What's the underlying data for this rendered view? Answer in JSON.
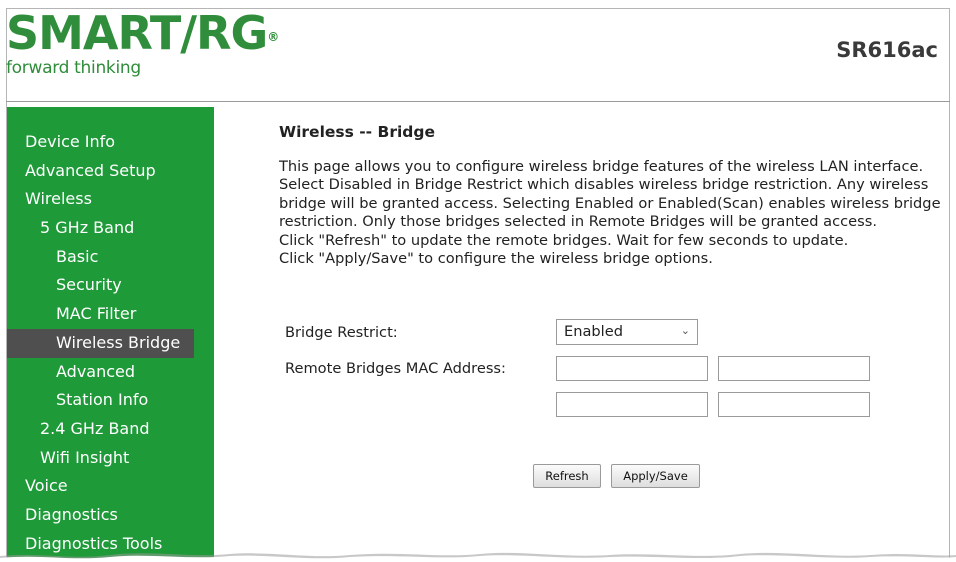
{
  "header": {
    "brand": "SMART/RG",
    "brand_mark": "®",
    "tagline": "forward thinking",
    "model": "SR616ac"
  },
  "sidebar": {
    "items": [
      {
        "label": "Device Info"
      },
      {
        "label": "Advanced Setup"
      },
      {
        "label": "Wireless"
      },
      {
        "label": "5 GHz Band"
      },
      {
        "label": "Basic"
      },
      {
        "label": "Security"
      },
      {
        "label": "MAC Filter"
      },
      {
        "label": "Wireless Bridge"
      },
      {
        "label": "Advanced"
      },
      {
        "label": "Station Info"
      },
      {
        "label": "2.4 GHz Band"
      },
      {
        "label": "Wifi Insight"
      },
      {
        "label": "Voice"
      },
      {
        "label": "Diagnostics"
      },
      {
        "label": "Diagnostics Tools"
      }
    ]
  },
  "main": {
    "title": "Wireless -- Bridge",
    "description": "This page allows you to configure wireless bridge features of the wireless LAN interface. Select Disabled in Bridge Restrict which disables wireless bridge restriction. Any wireless bridge will be granted access. Selecting Enabled or Enabled(Scan) enables wireless bridge restriction. Only those bridges selected in Remote Bridges will be granted access.\nClick \"Refresh\" to update the remote bridges. Wait for few seconds to update.\nClick \"Apply/Save\" to configure the wireless bridge options.",
    "bridge_restrict_label": "Bridge Restrict:",
    "bridge_restrict_value": "Enabled",
    "remote_bridges_label": "Remote Bridges MAC Address:",
    "mac_values": [
      "",
      "",
      "",
      ""
    ],
    "refresh_label": "Refresh",
    "apply_label": "Apply/Save"
  },
  "colors": {
    "brand_green": "#2f8d3b",
    "sidebar_green": "#1e9a39",
    "active_item": "#4f4f4f"
  }
}
